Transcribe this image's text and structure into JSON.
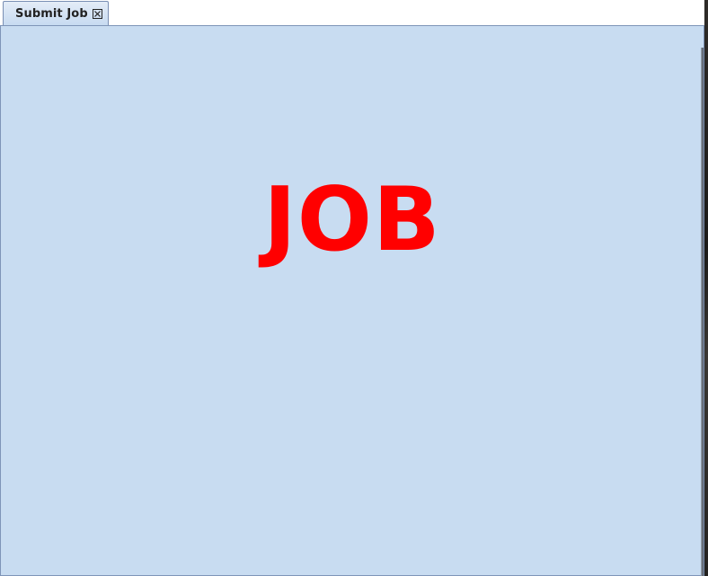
{
  "tabs": [
    {
      "label": "Submit Job",
      "close_icon": "close-box-icon"
    }
  ],
  "main": {
    "label": "JOB",
    "label_color": "#ff0000",
    "background_color": "#c8dcf1"
  }
}
